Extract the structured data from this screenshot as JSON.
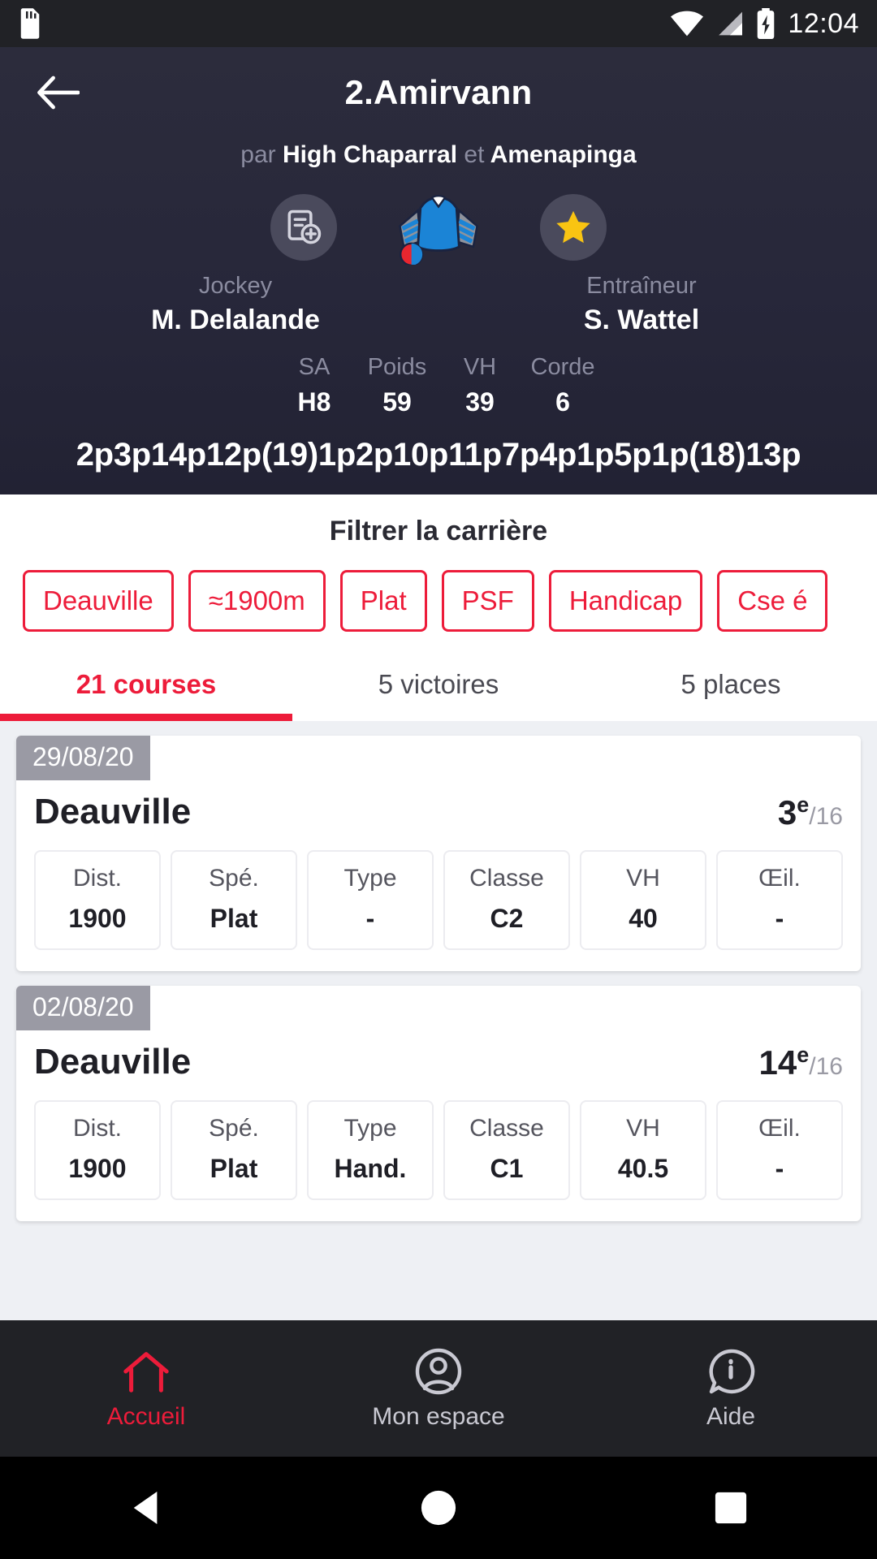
{
  "statusbar": {
    "time": "12:04",
    "icons": [
      "sd-card-icon",
      "wifi-icon",
      "signal-icon",
      "battery-charging-icon"
    ]
  },
  "header": {
    "back_icon": "back-arrow-icon",
    "title": "2.Amirvann",
    "pedigree_prefix": "par",
    "sire": "High Chaparral",
    "pedigree_join": "et",
    "dam": "Amenapinga",
    "note_icon": "add-note-icon",
    "silks_icon": "jockey-silks-icon",
    "favorite_icon": "star-icon",
    "jockey_role": "Jockey",
    "jockey_name": "M. Delalande",
    "trainer_role": "Entraîneur",
    "trainer_name": "S. Wattel",
    "stats": [
      {
        "label": "SA",
        "value": "H8"
      },
      {
        "label": "Poids",
        "value": "59"
      },
      {
        "label": "VH",
        "value": "39"
      },
      {
        "label": "Corde",
        "value": "6"
      }
    ],
    "form_line": "2p3p14p12p(19)1p2p10p11p7p4p1p5p1p(18)13p"
  },
  "filters": {
    "title": "Filtrer la carrière",
    "chips": [
      "Deauville",
      "≈1900m",
      "Plat",
      "PSF",
      "Handicap",
      "Cse é"
    ]
  },
  "tabs": [
    {
      "label": "21 courses",
      "active": true
    },
    {
      "label": "5 victoires",
      "active": false
    },
    {
      "label": "5 places",
      "active": false
    }
  ],
  "races": [
    {
      "date": "29/08/20",
      "track": "Deauville",
      "position": "3",
      "position_suffix": "e",
      "field_size": "/16",
      "boxes": [
        {
          "label": "Dist.",
          "value": "1900"
        },
        {
          "label": "Spé.",
          "value": "Plat"
        },
        {
          "label": "Type",
          "value": "-"
        },
        {
          "label": "Classe",
          "value": "C2"
        },
        {
          "label": "VH",
          "value": "40"
        },
        {
          "label": "Œil.",
          "value": "-"
        }
      ]
    },
    {
      "date": "02/08/20",
      "track": "Deauville",
      "position": "14",
      "position_suffix": "e",
      "field_size": "/16",
      "boxes": [
        {
          "label": "Dist.",
          "value": "1900"
        },
        {
          "label": "Spé.",
          "value": "Plat"
        },
        {
          "label": "Type",
          "value": "Hand."
        },
        {
          "label": "Classe",
          "value": "C1"
        },
        {
          "label": "VH",
          "value": "40.5"
        },
        {
          "label": "Œil.",
          "value": "-"
        }
      ]
    }
  ],
  "bottomnav": [
    {
      "label": "Accueil",
      "icon": "home-icon",
      "active": true
    },
    {
      "label": "Mon espace",
      "icon": "account-circle-icon",
      "active": false
    },
    {
      "label": "Aide",
      "icon": "help-chat-icon",
      "active": false
    }
  ],
  "androidnav": [
    "back-triangle-icon",
    "home-circle-icon",
    "recents-square-icon"
  ],
  "colors": {
    "accent": "#ed1c3a",
    "header_bg": "#2b2b3a",
    "nav_bg": "#212226",
    "list_bg": "#eef0f4",
    "badge_gray": "#9a9aa4",
    "star_gold": "#f9c412",
    "silks_blue": "#1b84d6"
  }
}
